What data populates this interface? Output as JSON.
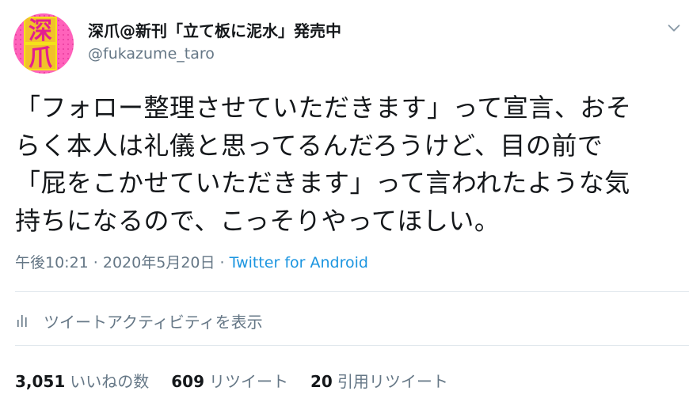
{
  "author": {
    "avatar_chars": [
      "深",
      "爪"
    ],
    "display_name": "深爪@新刊「立て板に泥水」発売中",
    "handle": "@fukazume_taro"
  },
  "tweet": {
    "text": "「フォロー整理させていただきます」って宣言、おそ\nらく本人は礼儀と思ってるんだろうけど、目の前で\n「屁をこかせていただきます」って言われたような気\n持ちになるので、こっそりやってほしい。",
    "timestamp": "午後10:21 · 2020年5月20日 · ",
    "source": "Twitter for Android"
  },
  "activity": {
    "label": "ツイートアクティビティを表示",
    "icon": "bar-chart-icon"
  },
  "stats": {
    "likes_count": "3,051",
    "likes_label": "いいねの数",
    "retweets_count": "609",
    "retweets_label": "リツイート",
    "quotes_count": "20",
    "quotes_label": "引用リツイート"
  },
  "colors": {
    "text_primary": "#14171a",
    "text_secondary": "#657786",
    "link": "#1b95e0",
    "divider": "#e1e8ed",
    "avatar_bg": "#ff4fb0"
  },
  "icons": {
    "menu": "chevron-down-icon"
  }
}
